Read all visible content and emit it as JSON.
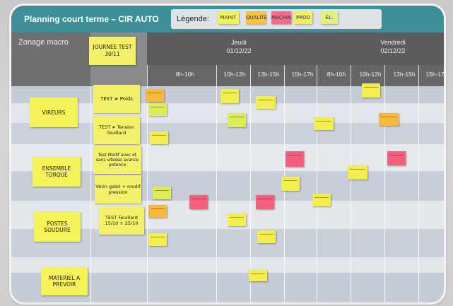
{
  "board": {
    "title": "Planning court terme – CIR AUTO",
    "legend_label": "Légende:",
    "legend_items": [
      {
        "label": "MAINT",
        "color": "#f1f25a"
      },
      {
        "label": "QUALITE",
        "color": "#f7c13c"
      },
      {
        "label": "MACHIN",
        "color": "#f56a8a"
      },
      {
        "label": "PROD",
        "color": "#f2f060"
      },
      {
        "label": "ÉL.",
        "color": "#e5f07a"
      }
    ],
    "zone_header": "Zonage macro",
    "test_header": "JOURNEE TEST 30/11",
    "days": [
      {
        "name": "Jeudi",
        "date": "01/12/22"
      },
      {
        "name": "Vendredi",
        "date": "02/12/22"
      }
    ],
    "slots": [
      "8h-10h",
      "10h-12h",
      "13h-15h",
      "15h-17h",
      "8h-10h",
      "10h-12h",
      "13h-15h",
      "15h-17h"
    ]
  },
  "zones": [
    {
      "label": "VIREURS"
    },
    {
      "label": "ENSEMBLE TORQUE"
    },
    {
      "label": "POSTES SOUDURE"
    },
    {
      "label": "MATERIEL A PREVOIR"
    }
  ],
  "tests": [
    {
      "label": "TEST ≠ Poids"
    },
    {
      "label": "TEST ≠ Tension feuillard"
    },
    {
      "label": "Test Modif avec et sans vitesse avance potence"
    },
    {
      "label": "Vérin galet + modif pression"
    },
    {
      "label": "TEST Feuillard 15/10 + 25/10"
    }
  ],
  "postit_colors": {
    "yellow": "#f2ee52",
    "orange": "#f6b93f",
    "pink": "#f2607d",
    "lime": "#dcec5c"
  }
}
